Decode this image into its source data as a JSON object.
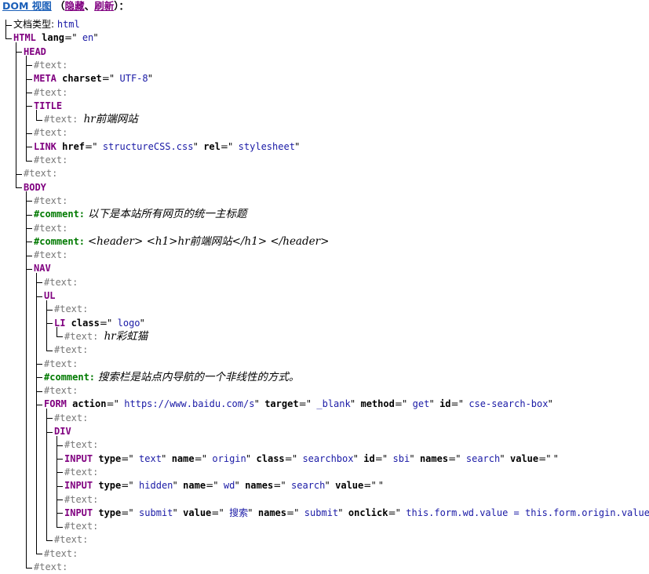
{
  "header": {
    "title": "DOM 视图",
    "open_paren": " （",
    "hide": "隐藏",
    "sep": "、",
    "refresh": "刷新",
    "close": "）："
  },
  "tree": [
    {
      "depth": 0,
      "name": "doctype",
      "parts": [
        [
          "plain",
          "文档类型: "
        ],
        [
          "val",
          "html"
        ]
      ]
    },
    {
      "depth": 0,
      "name": "html-node",
      "parts": [
        [
          "tag",
          "HTML"
        ],
        [
          "attr",
          " lang"
        ],
        [
          "plain",
          "=\""
        ],
        [
          "val",
          " en"
        ],
        [
          "plain",
          "\""
        ]
      ]
    },
    {
      "depth": 1,
      "name": "head-node",
      "parts": [
        [
          "tag",
          "HEAD"
        ]
      ]
    },
    {
      "depth": 2,
      "name": "text-node",
      "parts": [
        [
          "dim",
          "#text:"
        ]
      ]
    },
    {
      "depth": 2,
      "name": "meta-node",
      "parts": [
        [
          "tag",
          "META"
        ],
        [
          "attr",
          " charset"
        ],
        [
          "plain",
          "=\""
        ],
        [
          "val",
          " UTF-8"
        ],
        [
          "plain",
          "\""
        ]
      ]
    },
    {
      "depth": 2,
      "name": "text-node",
      "parts": [
        [
          "dim",
          "#text:"
        ]
      ]
    },
    {
      "depth": 2,
      "name": "title-node",
      "parts": [
        [
          "tag",
          "TITLE"
        ]
      ]
    },
    {
      "depth": 3,
      "name": "text-node",
      "parts": [
        [
          "dim",
          "#text: "
        ],
        [
          "ital",
          "hr前端网站"
        ]
      ]
    },
    {
      "depth": 2,
      "name": "text-node",
      "parts": [
        [
          "dim",
          "#text:"
        ]
      ]
    },
    {
      "depth": 2,
      "name": "link-node",
      "parts": [
        [
          "tag",
          "LINK"
        ],
        [
          "attr",
          " href"
        ],
        [
          "plain",
          "=\""
        ],
        [
          "val",
          " structureCSS.css"
        ],
        [
          "plain",
          "\""
        ],
        [
          "attr",
          " rel"
        ],
        [
          "plain",
          "=\""
        ],
        [
          "val",
          " stylesheet"
        ],
        [
          "plain",
          "\""
        ]
      ]
    },
    {
      "depth": 2,
      "name": "text-node",
      "parts": [
        [
          "dim",
          "#text:"
        ]
      ]
    },
    {
      "depth": 1,
      "name": "text-node",
      "parts": [
        [
          "dim",
          "#text:"
        ]
      ]
    },
    {
      "depth": 1,
      "name": "body-node",
      "parts": [
        [
          "tag",
          "BODY"
        ]
      ]
    },
    {
      "depth": 2,
      "name": "text-node",
      "parts": [
        [
          "dim",
          "#text:"
        ]
      ]
    },
    {
      "depth": 2,
      "name": "comment-node",
      "parts": [
        [
          "cmtlbl",
          "#comment:"
        ],
        [
          "plain",
          " "
        ],
        [
          "ital",
          "以下是本站所有网页的统一主标题"
        ]
      ]
    },
    {
      "depth": 2,
      "name": "text-node",
      "parts": [
        [
          "dim",
          "#text:"
        ]
      ]
    },
    {
      "depth": 2,
      "name": "comment-node",
      "parts": [
        [
          "cmtlbl",
          "#comment:"
        ],
        [
          "plain",
          " "
        ],
        [
          "ital",
          "<header> <h1>hr前端网站</h1> </header>"
        ]
      ]
    },
    {
      "depth": 2,
      "name": "text-node",
      "parts": [
        [
          "dim",
          "#text:"
        ]
      ]
    },
    {
      "depth": 2,
      "name": "nav-node",
      "parts": [
        [
          "tag",
          "NAV"
        ]
      ]
    },
    {
      "depth": 3,
      "name": "text-node",
      "parts": [
        [
          "dim",
          "#text:"
        ]
      ]
    },
    {
      "depth": 3,
      "name": "ul-node",
      "parts": [
        [
          "tag",
          "UL"
        ]
      ]
    },
    {
      "depth": 4,
      "name": "text-node",
      "parts": [
        [
          "dim",
          "#text:"
        ]
      ]
    },
    {
      "depth": 4,
      "name": "li-node",
      "parts": [
        [
          "tag",
          "LI"
        ],
        [
          "attr",
          " class"
        ],
        [
          "plain",
          "=\""
        ],
        [
          "val",
          " logo"
        ],
        [
          "plain",
          "\""
        ]
      ]
    },
    {
      "depth": 5,
      "name": "text-node",
      "parts": [
        [
          "dim",
          "#text: "
        ],
        [
          "ital",
          "hr彩虹猫"
        ]
      ]
    },
    {
      "depth": 4,
      "name": "text-node",
      "parts": [
        [
          "dim",
          "#text:"
        ]
      ]
    },
    {
      "depth": 3,
      "name": "text-node",
      "parts": [
        [
          "dim",
          "#text:"
        ]
      ]
    },
    {
      "depth": 3,
      "name": "comment-node",
      "parts": [
        [
          "cmtlbl",
          "#comment:"
        ],
        [
          "plain",
          " "
        ],
        [
          "ital",
          "搜索栏是站点内导航的一个非线性的方式。"
        ]
      ]
    },
    {
      "depth": 3,
      "name": "text-node",
      "parts": [
        [
          "dim",
          "#text:"
        ]
      ]
    },
    {
      "depth": 3,
      "name": "form-node",
      "parts": [
        [
          "tag",
          "FORM"
        ],
        [
          "attr",
          " action"
        ],
        [
          "plain",
          "=\""
        ],
        [
          "val",
          " https://www.baidu.com/s"
        ],
        [
          "plain",
          "\""
        ],
        [
          "attr",
          " target"
        ],
        [
          "plain",
          "=\""
        ],
        [
          "val",
          " _blank"
        ],
        [
          "plain",
          "\""
        ],
        [
          "attr",
          " method"
        ],
        [
          "plain",
          "=\""
        ],
        [
          "val",
          " get"
        ],
        [
          "plain",
          "\""
        ],
        [
          "attr",
          " id"
        ],
        [
          "plain",
          "=\""
        ],
        [
          "val",
          " cse-search-box"
        ],
        [
          "plain",
          "\""
        ]
      ]
    },
    {
      "depth": 4,
      "name": "text-node",
      "parts": [
        [
          "dim",
          "#text:"
        ]
      ]
    },
    {
      "depth": 4,
      "name": "div-node",
      "parts": [
        [
          "tag",
          "DIV"
        ]
      ]
    },
    {
      "depth": 5,
      "name": "text-node",
      "parts": [
        [
          "dim",
          "#text:"
        ]
      ]
    },
    {
      "depth": 5,
      "name": "input-node",
      "parts": [
        [
          "tag",
          "INPUT"
        ],
        [
          "attr",
          " type"
        ],
        [
          "plain",
          "=\""
        ],
        [
          "val",
          " text"
        ],
        [
          "plain",
          "\""
        ],
        [
          "attr",
          " name"
        ],
        [
          "plain",
          "=\""
        ],
        [
          "val",
          " origin"
        ],
        [
          "plain",
          "\""
        ],
        [
          "attr",
          " class"
        ],
        [
          "plain",
          "=\""
        ],
        [
          "val",
          " searchbox"
        ],
        [
          "plain",
          "\""
        ],
        [
          "attr",
          " id"
        ],
        [
          "plain",
          "=\""
        ],
        [
          "val",
          " sbi"
        ],
        [
          "plain",
          "\""
        ],
        [
          "attr",
          " names"
        ],
        [
          "plain",
          "=\""
        ],
        [
          "val",
          " search"
        ],
        [
          "plain",
          "\""
        ],
        [
          "attr",
          " value"
        ],
        [
          "plain",
          "=\" \""
        ]
      ]
    },
    {
      "depth": 5,
      "name": "text-node",
      "parts": [
        [
          "dim",
          "#text:"
        ]
      ]
    },
    {
      "depth": 5,
      "name": "input-node",
      "parts": [
        [
          "tag",
          "INPUT"
        ],
        [
          "attr",
          " type"
        ],
        [
          "plain",
          "=\""
        ],
        [
          "val",
          " hidden"
        ],
        [
          "plain",
          "\""
        ],
        [
          "attr",
          " name"
        ],
        [
          "plain",
          "=\""
        ],
        [
          "val",
          " wd"
        ],
        [
          "plain",
          "\""
        ],
        [
          "attr",
          " names"
        ],
        [
          "plain",
          "=\""
        ],
        [
          "val",
          " search"
        ],
        [
          "plain",
          "\""
        ],
        [
          "attr",
          " value"
        ],
        [
          "plain",
          "=\" \""
        ]
      ]
    },
    {
      "depth": 5,
      "name": "text-node",
      "parts": [
        [
          "dim",
          "#text:"
        ]
      ]
    },
    {
      "depth": 5,
      "name": "input-node",
      "parts": [
        [
          "tag",
          "INPUT"
        ],
        [
          "attr",
          " type"
        ],
        [
          "plain",
          "=\""
        ],
        [
          "val",
          " submit"
        ],
        [
          "plain",
          "\""
        ],
        [
          "attr",
          " value"
        ],
        [
          "plain",
          "=\""
        ],
        [
          "val",
          " 搜索"
        ],
        [
          "plain",
          "\""
        ],
        [
          "attr",
          " names"
        ],
        [
          "plain",
          "=\""
        ],
        [
          "val",
          " submit"
        ],
        [
          "plain",
          "\""
        ],
        [
          "attr",
          " onclick"
        ],
        [
          "plain",
          "=\""
        ],
        [
          "val",
          " this.form.wd.value = this.form.origin.value"
        ],
        [
          "plain",
          " \""
        ]
      ]
    },
    {
      "depth": 5,
      "name": "text-node",
      "parts": [
        [
          "dim",
          "#text:"
        ]
      ]
    },
    {
      "depth": 4,
      "name": "text-node",
      "parts": [
        [
          "dim",
          "#text:"
        ]
      ]
    },
    {
      "depth": 3,
      "name": "text-node",
      "parts": [
        [
          "dim",
          "#text:"
        ]
      ]
    },
    {
      "depth": 2,
      "name": "text-node",
      "parts": [
        [
          "dim",
          "#text:"
        ]
      ]
    }
  ]
}
